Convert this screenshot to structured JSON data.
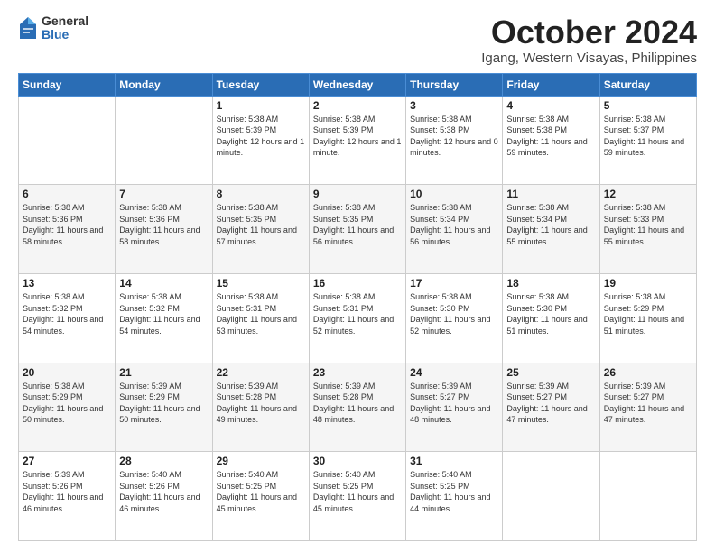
{
  "logo": {
    "general": "General",
    "blue": "Blue"
  },
  "title": {
    "month": "October 2024",
    "location": "Igang, Western Visayas, Philippines"
  },
  "weekdays": [
    "Sunday",
    "Monday",
    "Tuesday",
    "Wednesday",
    "Thursday",
    "Friday",
    "Saturday"
  ],
  "weeks": [
    [
      {
        "day": "",
        "info": ""
      },
      {
        "day": "",
        "info": ""
      },
      {
        "day": "1",
        "info": "Sunrise: 5:38 AM\nSunset: 5:39 PM\nDaylight: 12 hours\nand 1 minute."
      },
      {
        "day": "2",
        "info": "Sunrise: 5:38 AM\nSunset: 5:39 PM\nDaylight: 12 hours\nand 1 minute."
      },
      {
        "day": "3",
        "info": "Sunrise: 5:38 AM\nSunset: 5:38 PM\nDaylight: 12 hours\nand 0 minutes."
      },
      {
        "day": "4",
        "info": "Sunrise: 5:38 AM\nSunset: 5:38 PM\nDaylight: 11 hours\nand 59 minutes."
      },
      {
        "day": "5",
        "info": "Sunrise: 5:38 AM\nSunset: 5:37 PM\nDaylight: 11 hours\nand 59 minutes."
      }
    ],
    [
      {
        "day": "6",
        "info": "Sunrise: 5:38 AM\nSunset: 5:36 PM\nDaylight: 11 hours\nand 58 minutes."
      },
      {
        "day": "7",
        "info": "Sunrise: 5:38 AM\nSunset: 5:36 PM\nDaylight: 11 hours\nand 58 minutes."
      },
      {
        "day": "8",
        "info": "Sunrise: 5:38 AM\nSunset: 5:35 PM\nDaylight: 11 hours\nand 57 minutes."
      },
      {
        "day": "9",
        "info": "Sunrise: 5:38 AM\nSunset: 5:35 PM\nDaylight: 11 hours\nand 56 minutes."
      },
      {
        "day": "10",
        "info": "Sunrise: 5:38 AM\nSunset: 5:34 PM\nDaylight: 11 hours\nand 56 minutes."
      },
      {
        "day": "11",
        "info": "Sunrise: 5:38 AM\nSunset: 5:34 PM\nDaylight: 11 hours\nand 55 minutes."
      },
      {
        "day": "12",
        "info": "Sunrise: 5:38 AM\nSunset: 5:33 PM\nDaylight: 11 hours\nand 55 minutes."
      }
    ],
    [
      {
        "day": "13",
        "info": "Sunrise: 5:38 AM\nSunset: 5:32 PM\nDaylight: 11 hours\nand 54 minutes."
      },
      {
        "day": "14",
        "info": "Sunrise: 5:38 AM\nSunset: 5:32 PM\nDaylight: 11 hours\nand 54 minutes."
      },
      {
        "day": "15",
        "info": "Sunrise: 5:38 AM\nSunset: 5:31 PM\nDaylight: 11 hours\nand 53 minutes."
      },
      {
        "day": "16",
        "info": "Sunrise: 5:38 AM\nSunset: 5:31 PM\nDaylight: 11 hours\nand 52 minutes."
      },
      {
        "day": "17",
        "info": "Sunrise: 5:38 AM\nSunset: 5:30 PM\nDaylight: 11 hours\nand 52 minutes."
      },
      {
        "day": "18",
        "info": "Sunrise: 5:38 AM\nSunset: 5:30 PM\nDaylight: 11 hours\nand 51 minutes."
      },
      {
        "day": "19",
        "info": "Sunrise: 5:38 AM\nSunset: 5:29 PM\nDaylight: 11 hours\nand 51 minutes."
      }
    ],
    [
      {
        "day": "20",
        "info": "Sunrise: 5:38 AM\nSunset: 5:29 PM\nDaylight: 11 hours\nand 50 minutes."
      },
      {
        "day": "21",
        "info": "Sunrise: 5:39 AM\nSunset: 5:29 PM\nDaylight: 11 hours\nand 50 minutes."
      },
      {
        "day": "22",
        "info": "Sunrise: 5:39 AM\nSunset: 5:28 PM\nDaylight: 11 hours\nand 49 minutes."
      },
      {
        "day": "23",
        "info": "Sunrise: 5:39 AM\nSunset: 5:28 PM\nDaylight: 11 hours\nand 48 minutes."
      },
      {
        "day": "24",
        "info": "Sunrise: 5:39 AM\nSunset: 5:27 PM\nDaylight: 11 hours\nand 48 minutes."
      },
      {
        "day": "25",
        "info": "Sunrise: 5:39 AM\nSunset: 5:27 PM\nDaylight: 11 hours\nand 47 minutes."
      },
      {
        "day": "26",
        "info": "Sunrise: 5:39 AM\nSunset: 5:27 PM\nDaylight: 11 hours\nand 47 minutes."
      }
    ],
    [
      {
        "day": "27",
        "info": "Sunrise: 5:39 AM\nSunset: 5:26 PM\nDaylight: 11 hours\nand 46 minutes."
      },
      {
        "day": "28",
        "info": "Sunrise: 5:40 AM\nSunset: 5:26 PM\nDaylight: 11 hours\nand 46 minutes."
      },
      {
        "day": "29",
        "info": "Sunrise: 5:40 AM\nSunset: 5:25 PM\nDaylight: 11 hours\nand 45 minutes."
      },
      {
        "day": "30",
        "info": "Sunrise: 5:40 AM\nSunset: 5:25 PM\nDaylight: 11 hours\nand 45 minutes."
      },
      {
        "day": "31",
        "info": "Sunrise: 5:40 AM\nSunset: 5:25 PM\nDaylight: 11 hours\nand 44 minutes."
      },
      {
        "day": "",
        "info": ""
      },
      {
        "day": "",
        "info": ""
      }
    ]
  ]
}
